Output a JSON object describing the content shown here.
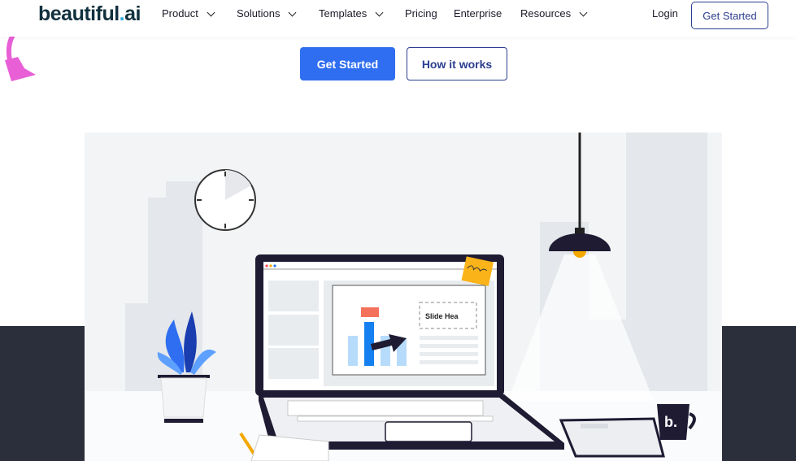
{
  "nav": {
    "logo_main": "beautiful",
    "logo_dot": ".",
    "logo_suffix": "ai",
    "items": [
      {
        "label": "Product",
        "has_dropdown": true
      },
      {
        "label": "Solutions",
        "has_dropdown": true
      },
      {
        "label": "Templates",
        "has_dropdown": true
      },
      {
        "label": "Pricing",
        "has_dropdown": false
      },
      {
        "label": "Enterprise",
        "has_dropdown": false
      },
      {
        "label": "Resources",
        "has_dropdown": true
      }
    ],
    "login": "Login",
    "cta": "Get Started"
  },
  "hero": {
    "primary_button": "Get Started",
    "secondary_button": "How it works"
  },
  "illustration": {
    "slide_heading": "Slide Hea",
    "mug_logo": "b."
  },
  "colors": {
    "primary": "#2f6ef0",
    "accent_arrow": "#e85fd6",
    "dark_band": "#2a2f3b",
    "logo": "#11303e"
  }
}
